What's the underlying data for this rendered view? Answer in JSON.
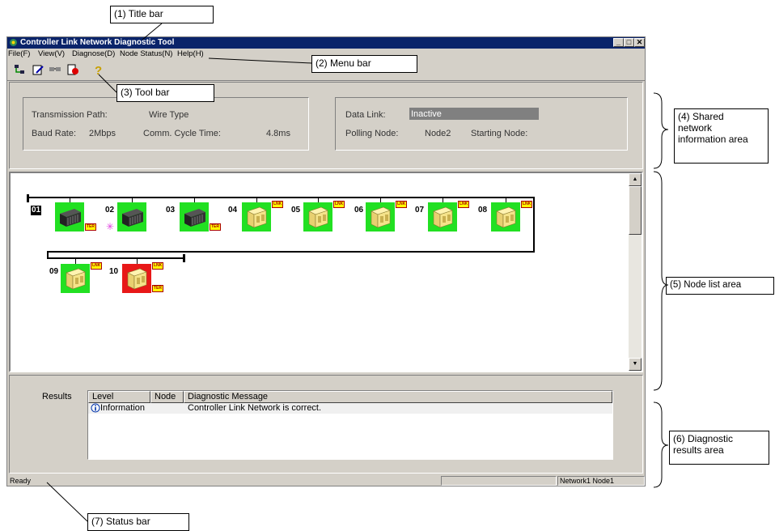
{
  "window": {
    "title": "Controller Link Network Diagnostic Tool",
    "controls": [
      "_",
      "□",
      "✕"
    ]
  },
  "menu": [
    "File(F)",
    "View(V)",
    "Diagnose(D)",
    "Node Status(N)",
    "Help(H)"
  ],
  "toolbar": {
    "buttons": [
      "network-icon",
      "edit-icon",
      "nodes-icon",
      "diagnose-icon",
      "help-icon"
    ]
  },
  "shared_info": {
    "transmission_path_label": "Transmission Path:",
    "transmission_path_value": "Wire Type",
    "baud_rate_label": "Baud Rate:",
    "baud_rate_value": "2Mbps",
    "cycle_time_label": "Comm. Cycle Time:",
    "cycle_time_value": "4.8ms",
    "data_link_label": "Data Link:",
    "data_link_value": "Inactive",
    "polling_node_label": "Polling Node:",
    "polling_node_value": "Node2",
    "starting_node_label": "Starting Node:",
    "starting_node_value": ""
  },
  "nodes": [
    {
      "num": "01",
      "status": "green",
      "type": "dark",
      "badges": [
        "TER"
      ],
      "selected": true
    },
    {
      "num": "02",
      "status": "green",
      "type": "dark",
      "badges": [],
      "polling": true
    },
    {
      "num": "03",
      "status": "green",
      "type": "dark",
      "badges": [
        "TER"
      ]
    },
    {
      "num": "04",
      "status": "green",
      "type": "yellow",
      "badges": [
        "LNK"
      ]
    },
    {
      "num": "05",
      "status": "green",
      "type": "yellow",
      "badges": [
        "LNK"
      ]
    },
    {
      "num": "06",
      "status": "green",
      "type": "yellow",
      "badges": [
        "LNK"
      ]
    },
    {
      "num": "07",
      "status": "green",
      "type": "yellow",
      "badges": [
        "LNK"
      ]
    },
    {
      "num": "08",
      "status": "green",
      "type": "yellow",
      "badges": [
        "LNK"
      ]
    },
    {
      "num": "09",
      "status": "green",
      "type": "yellow",
      "badges": [
        "LNK"
      ]
    },
    {
      "num": "10",
      "status": "red",
      "type": "yellow",
      "badges": [
        "LNK",
        "TER"
      ]
    }
  ],
  "status_colors": {
    "green": "#22e022",
    "red": "#e81818"
  },
  "results": {
    "label": "Results",
    "columns": [
      "Level",
      "Node",
      "Diagnostic Message"
    ],
    "rows": [
      {
        "level": "Information",
        "node": "",
        "message": "Controller Link Network is correct."
      }
    ]
  },
  "statusbar": {
    "text": "Ready",
    "right": "Network1 Node1"
  },
  "callouts": {
    "title_bar": "(1) Title bar",
    "menu_bar": "(2) Menu bar",
    "tool_bar": "(3) Tool bar",
    "shared_info": "(4) Shared network information area",
    "node_list": "(5) Node list area",
    "diagnostic": "(6) Diagnostic results area",
    "status_bar": "(7) Status bar"
  }
}
